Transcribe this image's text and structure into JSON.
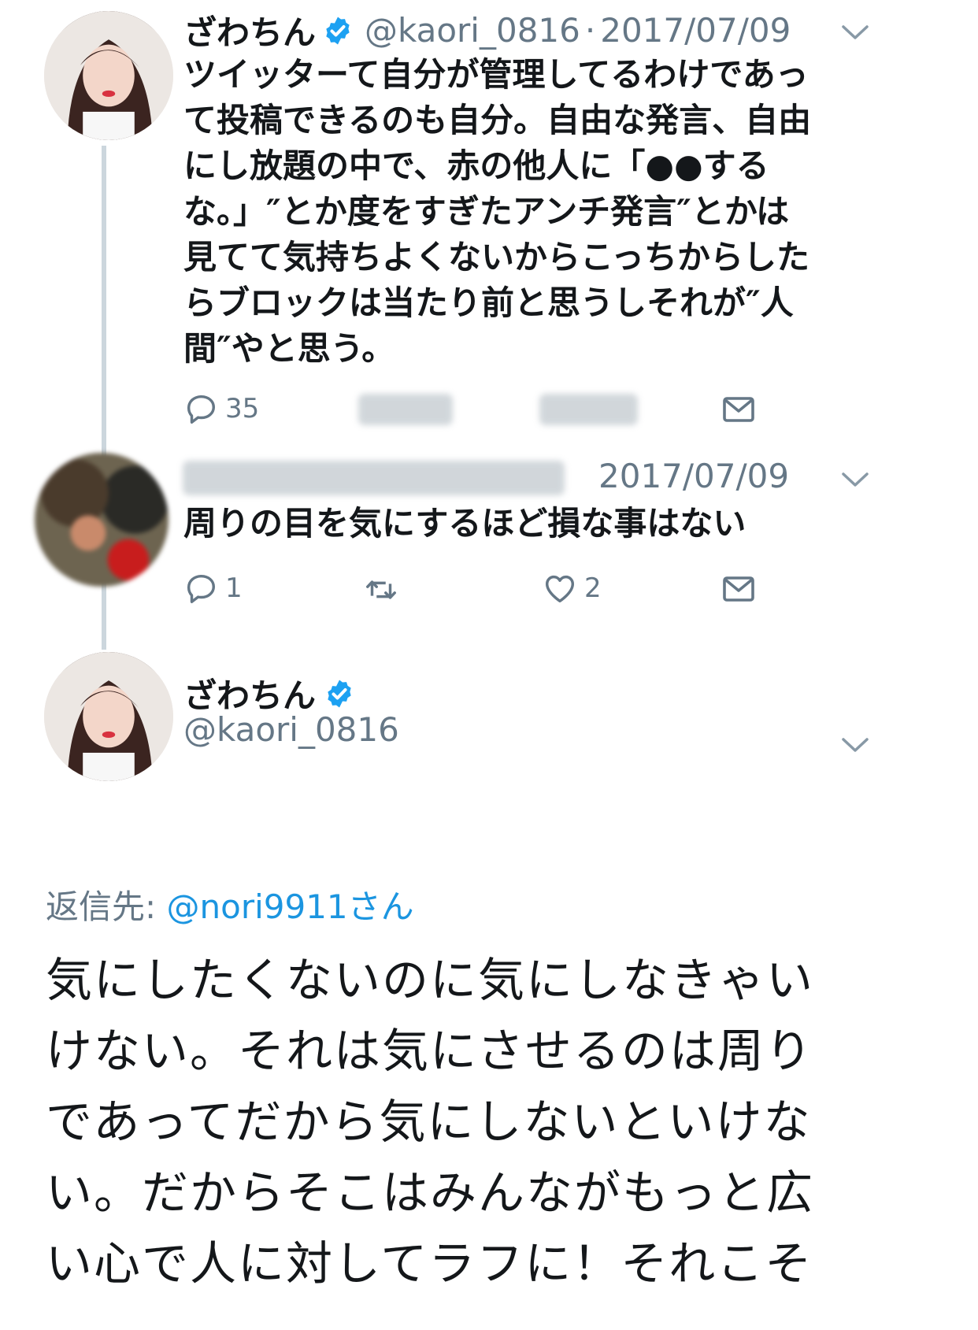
{
  "tweet1": {
    "name": "ざわちん",
    "handle": "@kaori_0816",
    "separator": "·",
    "date": "2017/07/09",
    "text_lines": [
      "ツイッターて自分が管理してるわけであっ",
      "て投稿できるのも自分。自由な発言、自由",
      "にし放題の中で、赤の他人に「●●する",
      "な。」″とか度をすぎたアンチ発言″とかは",
      "見てて気持ちよくないからこっちからした",
      "らブロックは当たり前と思うしそれが″人",
      "間″やと思う。"
    ],
    "reply_count": "35"
  },
  "tweet2": {
    "date": "2017/07/09",
    "text": "周りの目を気にするほど損な事はない",
    "reply_count": "1",
    "like_count": "2"
  },
  "tweet3": {
    "name": "ざわちん",
    "handle": "@kaori_0816",
    "reply_label": "返信先:",
    "reply_to": "@nori9911さん",
    "text_lines": [
      "気にしたくないのに気にしなきゃい",
      "けない。それは気にさせるのは周り",
      "であってだから気にしないといけな",
      "い。だからそこはみんながもっと広",
      "い心で人に対してラフに！それこそ"
    ]
  },
  "colors": {
    "text": "#14171a",
    "secondary": "#657786",
    "verified": "#1da1f2",
    "link": "#1b95e0",
    "thread": "#ccd6dd"
  },
  "icons": [
    "verified-icon",
    "chevron-down-icon",
    "reply-icon",
    "retweet-icon",
    "like-icon",
    "dm-icon"
  ]
}
